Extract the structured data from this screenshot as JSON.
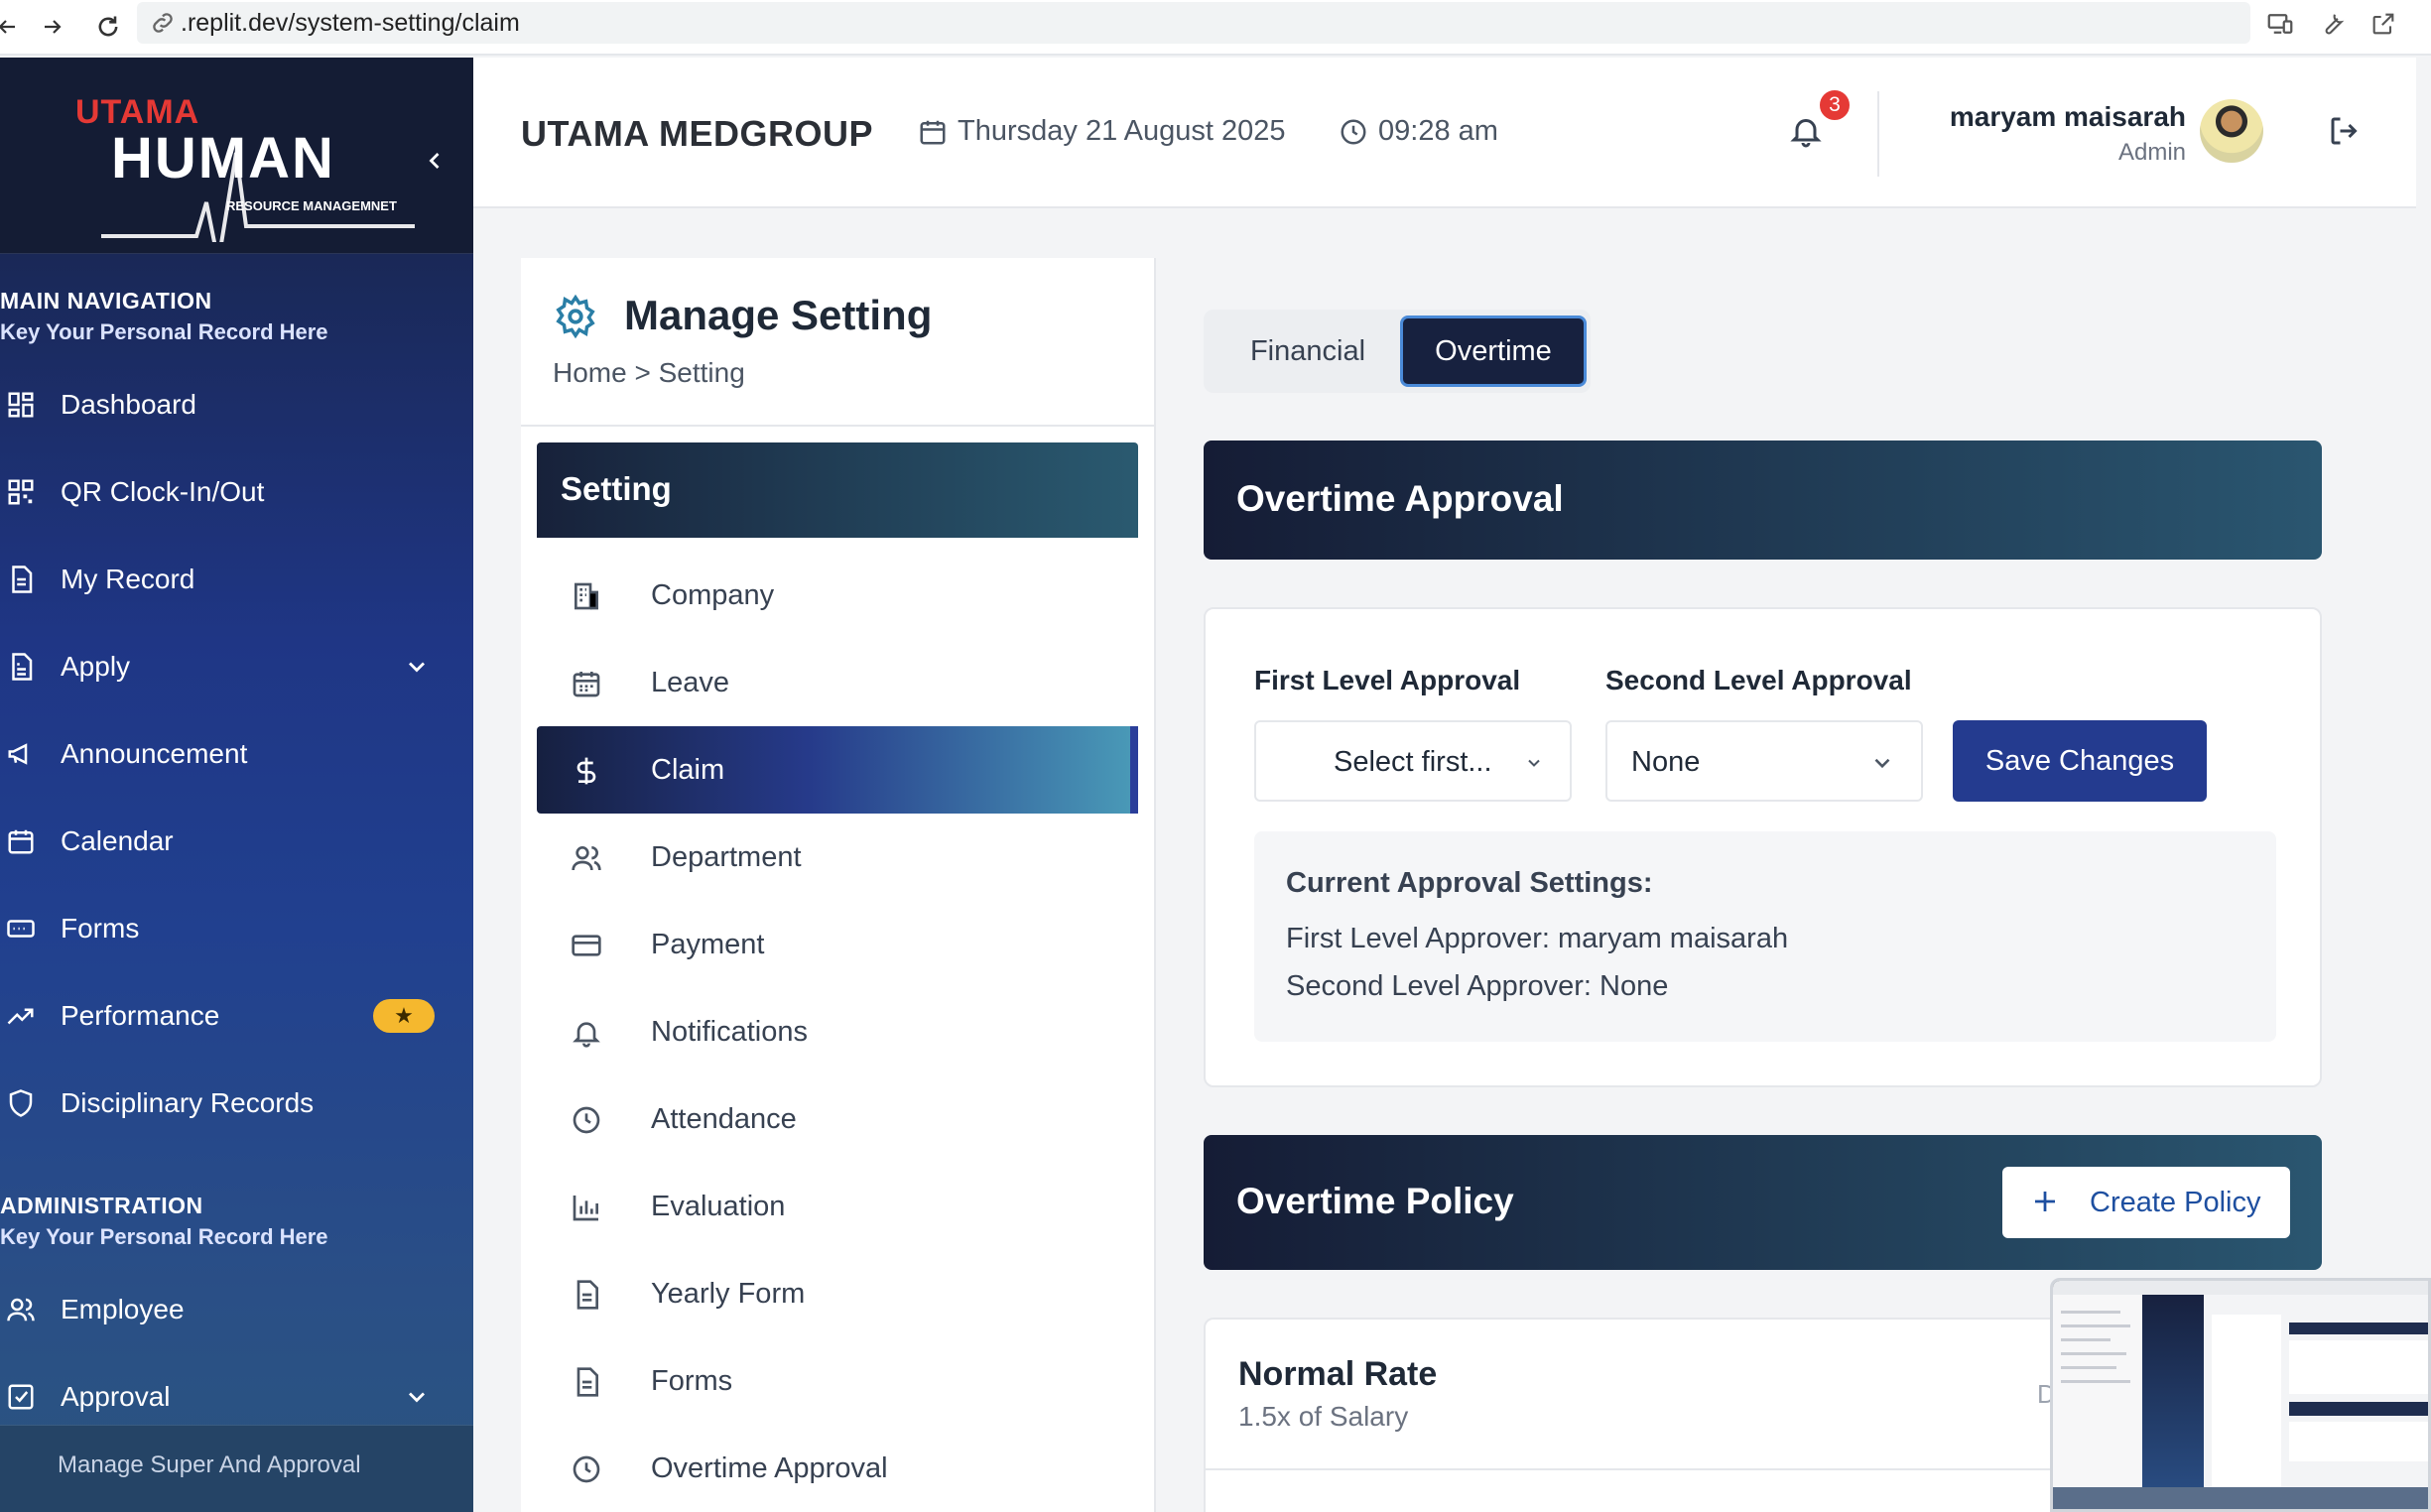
{
  "browser": {
    "url_prefix": ".replit.dev",
    "url_path": "/system-setting/claim"
  },
  "sidebar": {
    "logo_top": "UTAMA",
    "logo_main": "HUMAN",
    "logo_sub": "RESOURCE MANAGEMNET",
    "main_nav_title": "MAIN NAVIGATION",
    "main_nav_sub": "Key Your Personal Record Here",
    "items": [
      {
        "label": "Dashboard",
        "icon": "dashboard-icon"
      },
      {
        "label": "QR Clock-In/Out",
        "icon": "qr-code-icon"
      },
      {
        "label": "My Record",
        "icon": "document-icon"
      },
      {
        "label": "Apply",
        "icon": "apply-document-icon"
      },
      {
        "label": "Announcement",
        "icon": "megaphone-icon"
      },
      {
        "label": "Calendar",
        "icon": "calendar-icon"
      },
      {
        "label": "Forms",
        "icon": "forms-icon"
      },
      {
        "label": "Performance",
        "icon": "trending-up-icon"
      },
      {
        "label": "Disciplinary Records",
        "icon": "shield-icon"
      }
    ],
    "admin_title": "ADMINISTRATION",
    "admin_sub": "Key Your Personal Record Here",
    "admin_items": [
      {
        "label": "Employee",
        "icon": "users-icon"
      },
      {
        "label": "Approval",
        "icon": "checkbox-icon"
      }
    ],
    "sub_item": "Manage Super And Approval",
    "performance_badge": "★"
  },
  "header": {
    "company": "UTAMA MEDGROUP",
    "date": "Thursday 21 August 2025",
    "time": "09:28 am",
    "notification_count": "3",
    "user_name": "maryam maisarah",
    "user_role": "Admin"
  },
  "manage": {
    "title": "Manage Setting",
    "breadcrumb": "Home > Setting",
    "menu_title": "Setting",
    "menu": [
      {
        "label": "Company",
        "icon": "building-icon"
      },
      {
        "label": "Leave",
        "icon": "calendar-icon"
      },
      {
        "label": "Claim",
        "icon": "dollar-icon"
      },
      {
        "label": "Department",
        "icon": "users-icon"
      },
      {
        "label": "Payment",
        "icon": "credit-card-icon"
      },
      {
        "label": "Notifications",
        "icon": "bell-icon"
      },
      {
        "label": "Attendance",
        "icon": "clock-icon"
      },
      {
        "label": "Evaluation",
        "icon": "bar-chart-icon"
      },
      {
        "label": "Yearly Form",
        "icon": "document-icon"
      },
      {
        "label": "Forms",
        "icon": "document-icon"
      },
      {
        "label": "Overtime Approval",
        "icon": "clock-icon"
      }
    ],
    "active_item": "Claim"
  },
  "content": {
    "tabs": [
      "Financial",
      "Overtime"
    ],
    "active_tab": "Overtime",
    "approval_title": "Overtime Approval",
    "first_label": "First Level Approval",
    "second_label": "Second Level Approval",
    "first_value": "Select first...",
    "second_value": "None",
    "save_label": "Save Changes",
    "current_title": "Current Approval Settings:",
    "first_approver_label": "First Level Approver:",
    "first_approver_value": "maryam maisarah",
    "second_approver_label": "Second Level Approver:",
    "second_approver_value": "None",
    "policy_title": "Overtime Policy",
    "create_label": "Create Policy",
    "rate_name": "Normal Rate",
    "rate_desc": "1.5x of Salary",
    "rate_trailing": "D"
  },
  "colors": {
    "sidebar_dark": "#17213f",
    "accent_blue": "#243b8f",
    "notification_red": "#e53935",
    "badge_yellow": "#f5b82e"
  }
}
